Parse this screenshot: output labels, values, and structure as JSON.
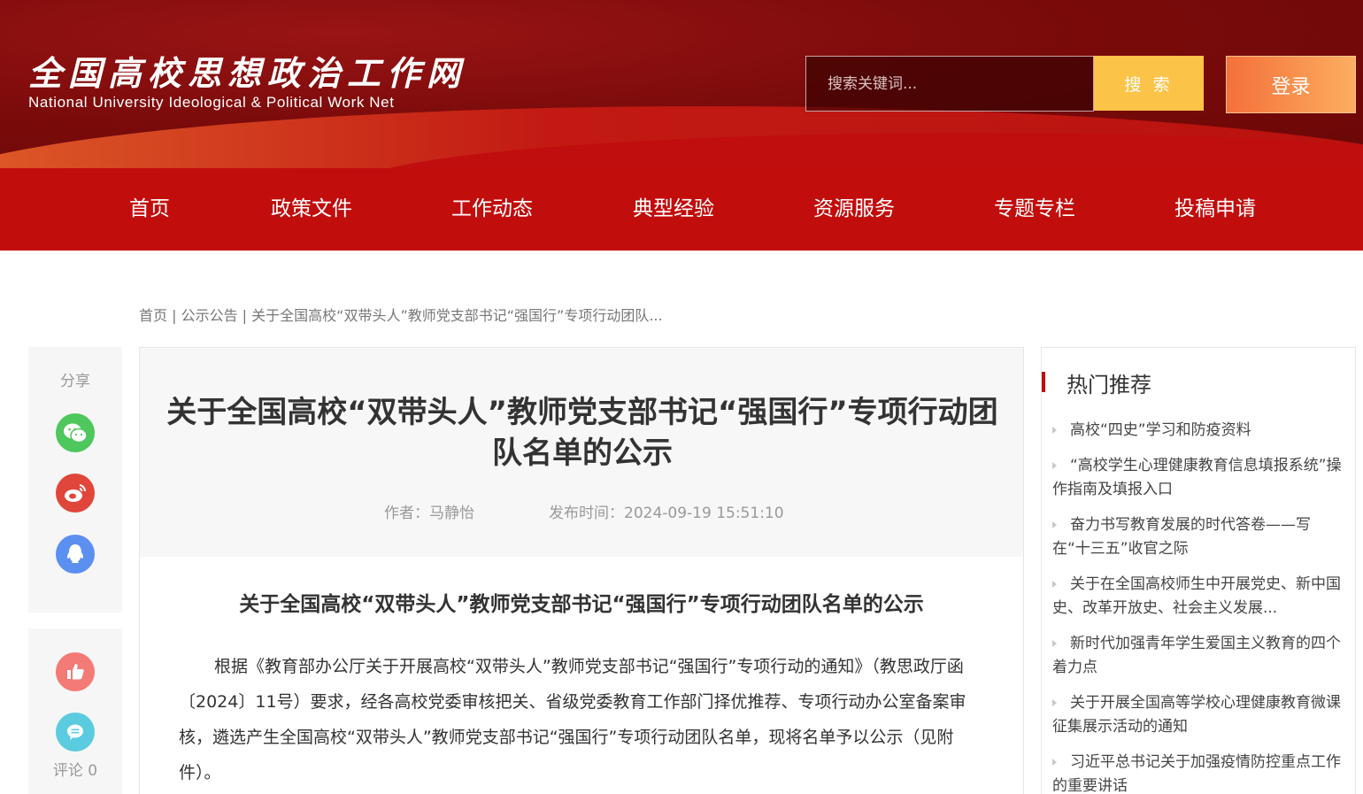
{
  "header": {
    "logo_cn": "全国高校思想政治工作网",
    "logo_en": "National University Ideological & Political Work Net",
    "search_placeholder": "搜索关键词...",
    "search_button": "搜 索",
    "login_button": "登录"
  },
  "nav": {
    "items": [
      "首页",
      "政策文件",
      "工作动态",
      "典型经验",
      "资源服务",
      "专题专栏",
      "投稿申请"
    ]
  },
  "breadcrumb": {
    "home": "首页",
    "section": "公示公告",
    "current": "关于全国高校“双带头人”教师党支部书记“强国行”专项行动团队...",
    "separator": " | "
  },
  "share": {
    "label": "分享",
    "comment_label": "评论 0"
  },
  "article": {
    "title": "关于全国高校“双带头人”教师党支部书记“强国行”专项行动团队名单的公示",
    "author": "作者：马静怡",
    "published": "发布时间：2024-09-19 15:51:10",
    "body_title": "关于全国高校“双带头人”教师党支部书记“强国行”专项行动团队名单的公示",
    "body_text": "根据《教育部办公厅关于开展高校“双带头人”教师党支部书记“强国行”专项行动的通知》（教思政厅函〔2024〕11号）要求，经各高校党委审核把关、省级党委教育工作部门择优推荐、专项行动办公室备案审核，遴选产生全国高校“双带头人”教师党支部书记“强国行”专项行动团队名单，现将名单予以公示（见附件）。"
  },
  "hot": {
    "title": "热门推荐",
    "items": [
      "高校“四史”学习和防疫资料",
      "“高校学生心理健康教育信息填报系统”操作指南及填报入口",
      "奋力书写教育发展的时代答卷——写在“十三五”收官之际",
      "关于在全国高校师生中开展党史、新中国史、改革开放史、社会主义发展...",
      "新时代加强青年学生爱国主义教育的四个着力点",
      "关于开展全国高等学校心理健康教育微课征集展示活动的通知",
      "习近平总书记关于加强疫情防控重点工作的重要讲话"
    ]
  },
  "colors": {
    "brand_red": "#c20d0d",
    "search_yellow": "#fbc348",
    "login_orange": "#f4703a"
  }
}
